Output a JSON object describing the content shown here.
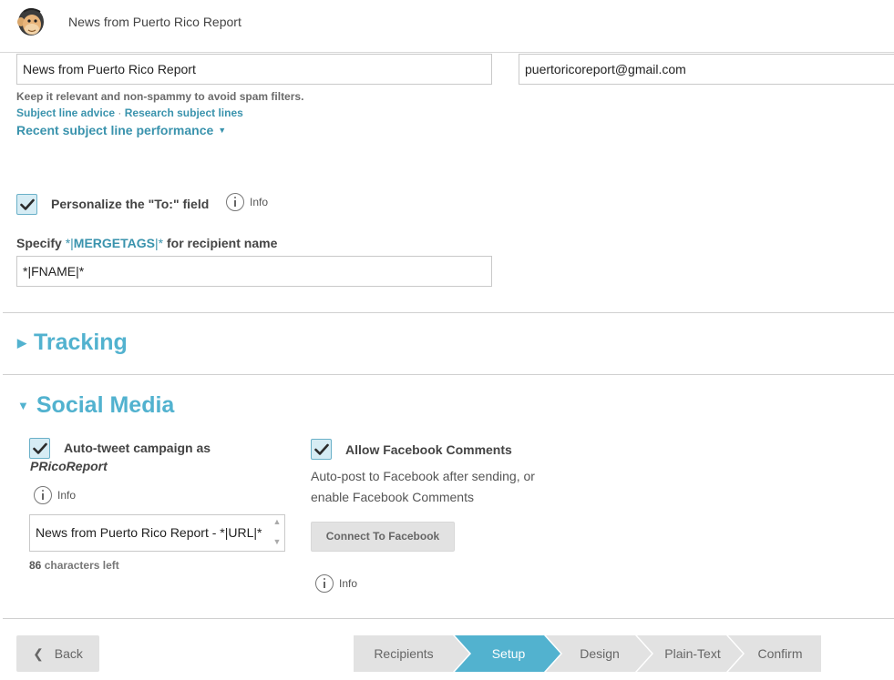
{
  "header": {
    "title": "News from Puerto Rico Report"
  },
  "subject": {
    "value": "News from Puerto Rico Report",
    "hint": "Keep it relevant and non-spammy to avoid spam filters.",
    "advice_link": "Subject line advice",
    "separator": "·",
    "research_link": "Research subject lines",
    "performance_link": "Recent subject line performance"
  },
  "from_email": {
    "value": "puertoricoreport@gmail.com"
  },
  "personalize": {
    "checked": true,
    "label": "Personalize the \"To:\" field",
    "info_label": "Info",
    "merge_prefix": "Specify ",
    "merge_tag_open": "*|",
    "merge_tag_word": "MERGETAGS",
    "merge_tag_close": "|*",
    "merge_suffix": " for recipient name",
    "merge_value": "*|FNAME|*"
  },
  "tracking": {
    "title": "Tracking",
    "expanded": false
  },
  "social": {
    "title": "Social Media",
    "expanded": true,
    "tweet": {
      "checked": true,
      "label": "Auto-tweet campaign as",
      "handle": "PRicoReport",
      "info_label": "Info",
      "text": "News from Puerto Rico Report - *|URL|*",
      "chars_left_count": "86",
      "chars_left_label": "characters left"
    },
    "facebook": {
      "checked": true,
      "label": "Allow Facebook Comments",
      "desc_line1": "Auto-post to Facebook after sending, or",
      "desc_line2": "enable Facebook Comments",
      "connect_button": "Connect To Facebook",
      "info_label": "Info"
    }
  },
  "footer": {
    "back_label": "Back",
    "steps": [
      {
        "label": "Recipients",
        "active": false
      },
      {
        "label": "Setup",
        "active": true
      },
      {
        "label": "Design",
        "active": false
      },
      {
        "label": "Plain-Text",
        "active": false
      },
      {
        "label": "Confirm",
        "active": false
      }
    ]
  },
  "colors": {
    "accent": "#52b2cf",
    "link": "#3a93ad",
    "step_inactive": "#e2e2e2",
    "step_active": "#52b2cf"
  },
  "icons": {
    "logo": "mailchimp-monkey-icon",
    "check": "checkmark-icon",
    "info": "info-circle-icon",
    "back": "chevron-left-icon"
  }
}
